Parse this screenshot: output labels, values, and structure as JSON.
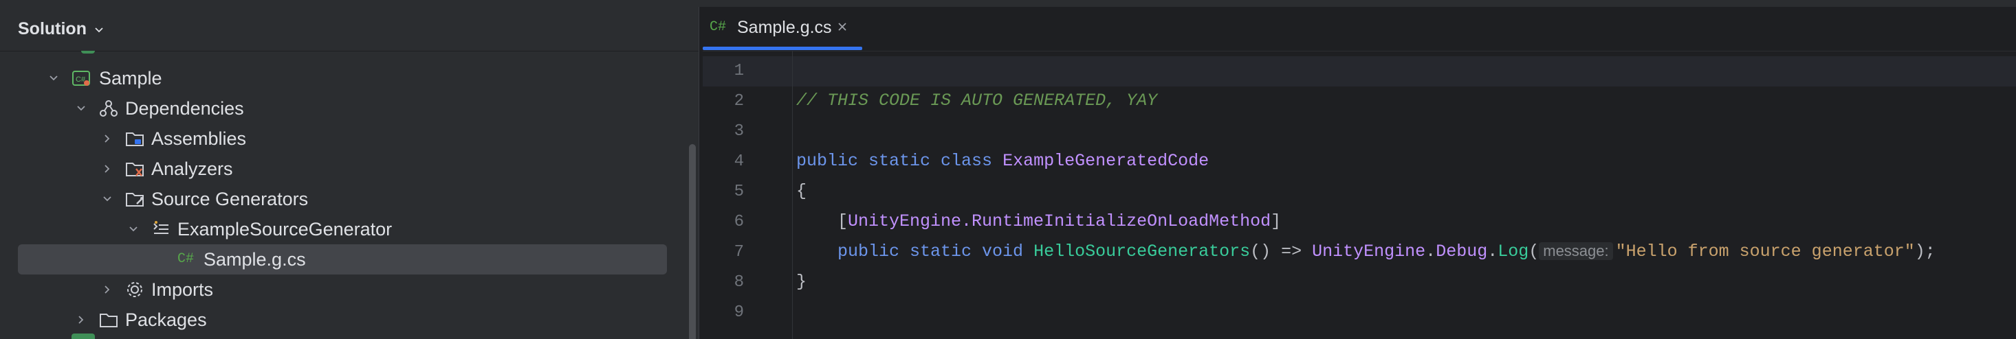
{
  "sidebar": {
    "title": "Solution",
    "tree": [
      {
        "label": "Sample",
        "icon": "csharp-project-icon",
        "expanded": true
      },
      {
        "label": "Dependencies",
        "icon": "dependencies-icon",
        "expanded": true
      },
      {
        "label": "Assemblies",
        "icon": "folder-icon",
        "expanded": false
      },
      {
        "label": "Analyzers",
        "icon": "folder-analyzer-icon",
        "expanded": false
      },
      {
        "label": "Source Generators",
        "icon": "folder-generator-icon",
        "expanded": true
      },
      {
        "label": "ExampleSourceGenerator",
        "icon": "generator-icon",
        "expanded": true
      },
      {
        "label": "Sample.g.cs",
        "icon": "csharp-file-icon",
        "selected": true
      },
      {
        "label": "Imports",
        "icon": "gear-icon",
        "expanded": false
      },
      {
        "label": "Packages",
        "icon": "folder-icon",
        "expanded": false
      }
    ]
  },
  "editor": {
    "tab": {
      "lang": "C#",
      "name": "Sample.g.cs"
    },
    "line_numbers": [
      "1",
      "2",
      "3",
      "4",
      "5",
      "6",
      "7",
      "8",
      "9"
    ],
    "code": {
      "l2_comment": "// THIS CODE IS AUTO GENERATED, YAY",
      "l4_kw": "public static class ",
      "l4_type": "ExampleGeneratedCode",
      "l5": "{",
      "l6_open": "    [",
      "l6_attr": "UnityEngine.RuntimeInitializeOnLoadMethod",
      "l6_close": "]",
      "l7_kw": "    public static void ",
      "l7_method": "HelloSourceGenerators",
      "l7_arrow": "() => ",
      "l7_type1": "UnityEngine",
      "l7_dot1": ".",
      "l7_type2": "Debug",
      "l7_dot2": ".",
      "l7_call": "Log",
      "l7_paren": "(",
      "l7_hint": "message:",
      "l7_str": "\"Hello from source generator\"",
      "l7_end": ");",
      "l8": "}"
    }
  },
  "colors": {
    "accent": "#3574f0",
    "keyword": "#6c95eb",
    "type": "#c191ff",
    "method": "#39cc9b",
    "string": "#c9a26d",
    "comment": "#6a9955"
  }
}
